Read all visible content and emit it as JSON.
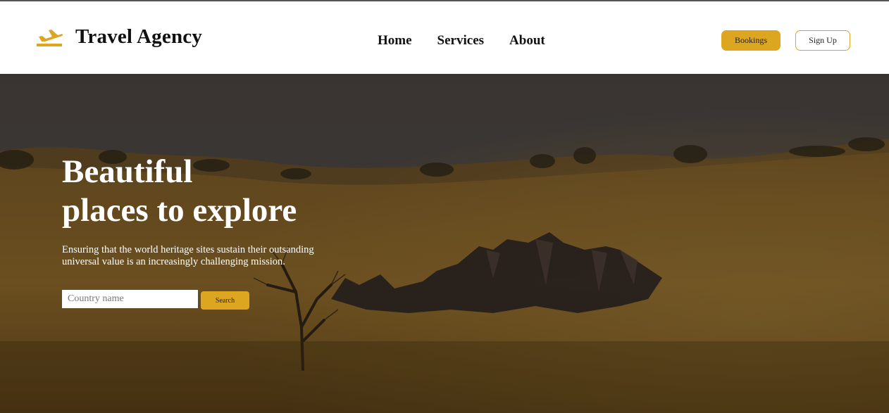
{
  "header": {
    "brand": "Travel Agency",
    "logo_icon": "airplane-takeoff-icon",
    "nav": [
      {
        "label": "Home"
      },
      {
        "label": "Services"
      },
      {
        "label": "About"
      }
    ],
    "bookings_label": "Bookings",
    "signup_label": "Sign Up"
  },
  "hero": {
    "title_line1": "Beautiful",
    "title_line2": "places to explore",
    "subtitle": "Ensuring that the world heritage sites sustain their outsanding universal value is an increasingly challenging mission.",
    "search": {
      "placeholder": "Country name",
      "value": "",
      "button_label": "Search"
    }
  },
  "colors": {
    "accent": "#dda621",
    "header_bg": "#ffffff",
    "text": "#111111"
  }
}
